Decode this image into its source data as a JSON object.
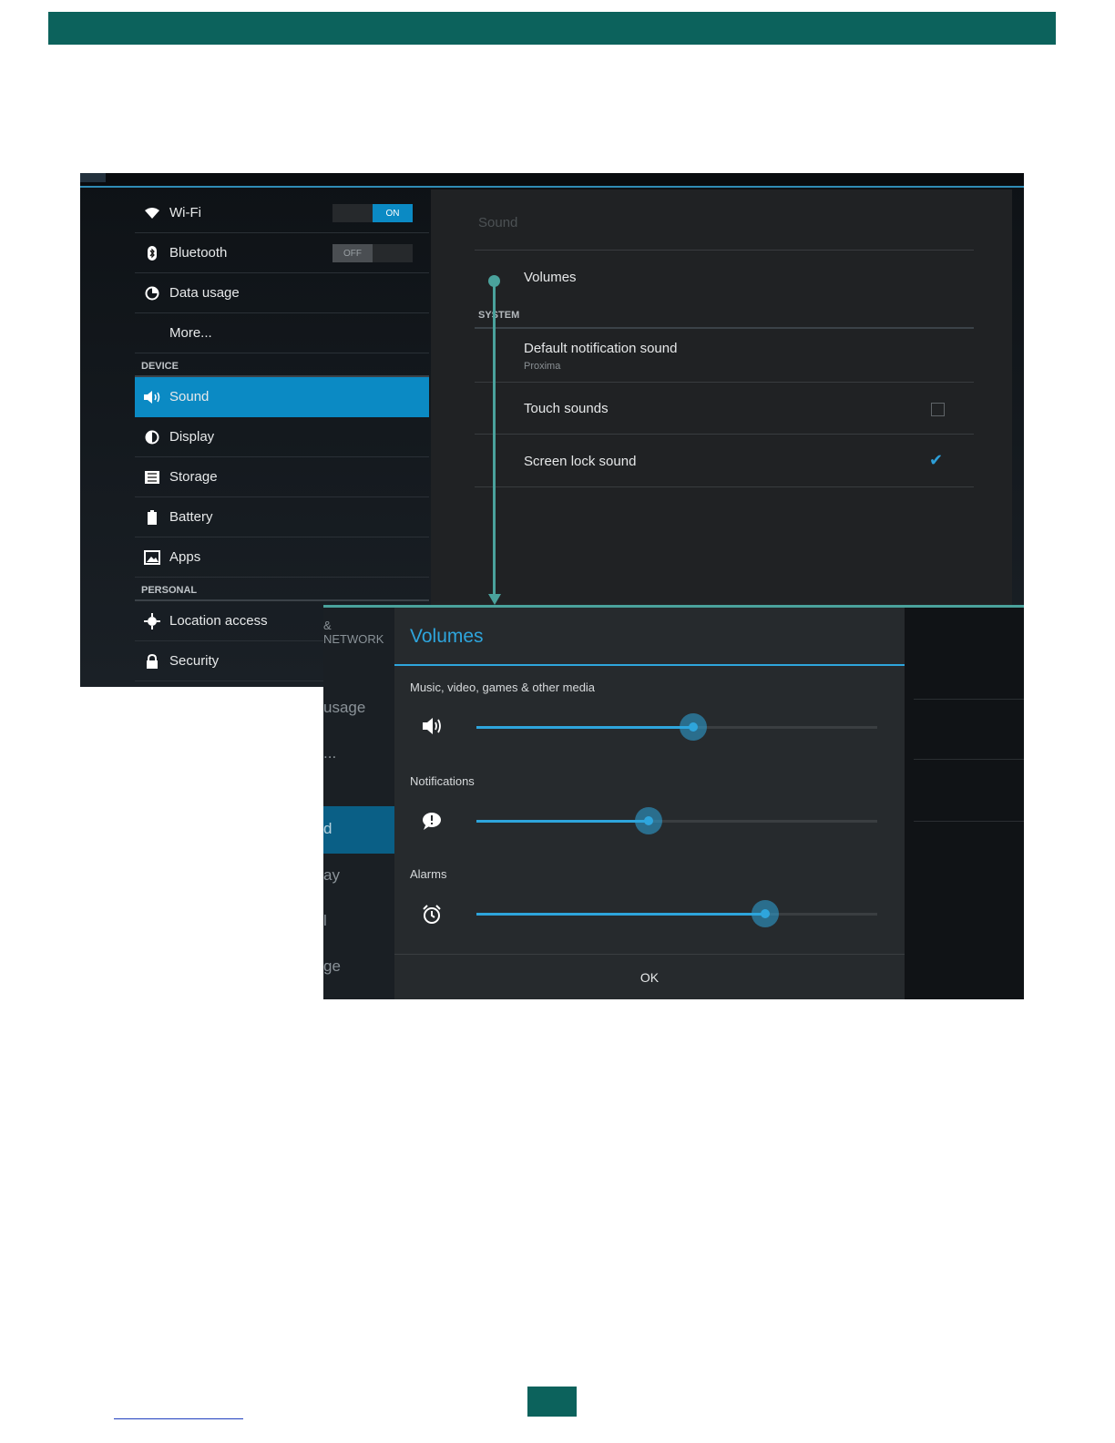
{
  "colors": {
    "brand": "#0c625c",
    "accent": "#0b8ac4",
    "dialog_accent": "#2ea5dc",
    "connector": "#4aa29c"
  },
  "settings": {
    "sidebar": {
      "wifi": {
        "label": "Wi-Fi",
        "toggle": "ON",
        "icon": "wifi-icon"
      },
      "bluetooth": {
        "label": "Bluetooth",
        "toggle": "OFF",
        "icon": "bluetooth-icon"
      },
      "data_usage": {
        "label": "Data usage",
        "icon": "data-usage-icon"
      },
      "more": {
        "label": "More..."
      },
      "device_header": "DEVICE",
      "sound": {
        "label": "Sound",
        "icon": "speaker-icon"
      },
      "display": {
        "label": "Display",
        "icon": "display-icon"
      },
      "storage": {
        "label": "Storage",
        "icon": "storage-icon"
      },
      "battery": {
        "label": "Battery",
        "icon": "battery-icon"
      },
      "apps": {
        "label": "Apps",
        "icon": "apps-icon"
      },
      "personal_header": "PERSONAL",
      "location": {
        "label": "Location access",
        "icon": "location-icon"
      },
      "security": {
        "label": "Security",
        "icon": "lock-icon"
      }
    },
    "panel": {
      "title": "Sound",
      "volumes": "Volumes",
      "system_header": "SYSTEM",
      "default_notification": {
        "label": "Default notification sound",
        "value": "Proxima"
      },
      "touch_sounds": {
        "label": "Touch sounds",
        "checked": false
      },
      "screen_lock": {
        "label": "Screen lock sound",
        "checked": true
      }
    }
  },
  "background_fragments": {
    "network": "& NETWORK",
    "usage": "usage",
    "more": "...",
    "sound": "d",
    "display": "ay",
    "storage": "l",
    "storage2": "ge"
  },
  "volumes_dialog": {
    "title": "Volumes",
    "media": {
      "label": "Music, video, games & other media",
      "level": 0.54,
      "icon": "speaker-icon"
    },
    "notifications": {
      "label": "Notifications",
      "level": 0.43,
      "icon": "notification-icon"
    },
    "alarms": {
      "label": "Alarms",
      "level": 0.72,
      "icon": "alarm-clock-icon"
    },
    "ok_label": "OK"
  }
}
